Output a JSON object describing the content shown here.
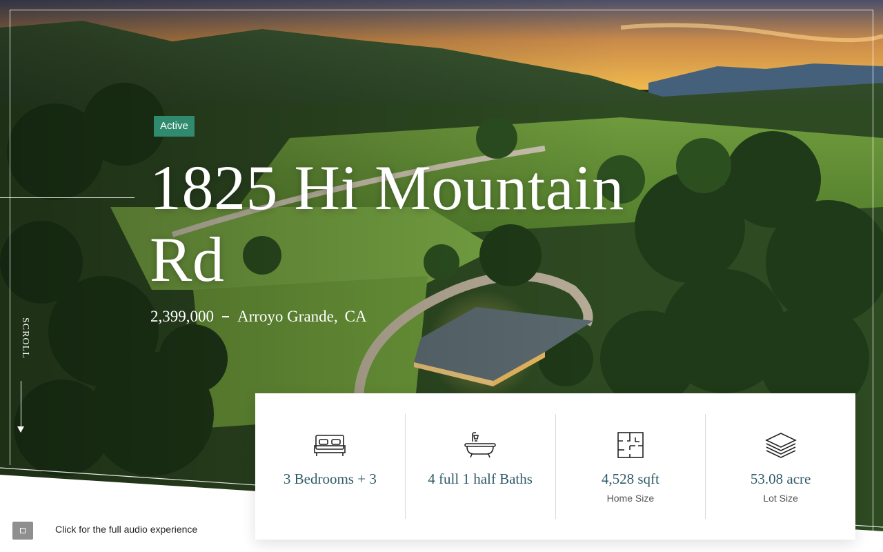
{
  "listing": {
    "status": "Active",
    "address_line": "1825 Hi Mountain Rd",
    "price": "2,399,000",
    "city": "Arroyo Grande,",
    "state": "CA"
  },
  "scroll": {
    "label": "SCROLL"
  },
  "audio": {
    "label": "Click for the full audio experience"
  },
  "stats": [
    {
      "icon": "bed-icon",
      "value": "3 Bedrooms + 3",
      "label": ""
    },
    {
      "icon": "bathtub-icon",
      "value": "4 full 1 half Baths",
      "label": ""
    },
    {
      "icon": "floorplan-icon",
      "value": "4,528 sqft",
      "label": "Home Size"
    },
    {
      "icon": "layers-icon",
      "value": "53.08 acre",
      "label": "Lot Size"
    }
  ],
  "colors": {
    "badge": "#2f8a6e",
    "stat_value": "#2f5a68",
    "divider": "#d9d9d9"
  }
}
